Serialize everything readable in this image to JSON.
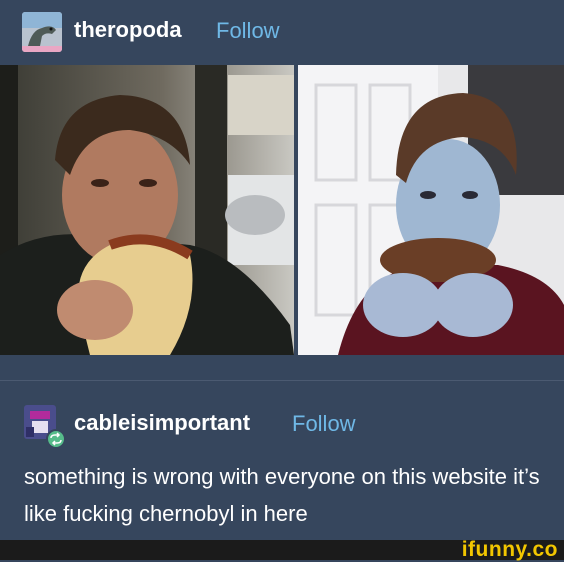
{
  "post": {
    "author": "theropoda",
    "follow_label": "Follow",
    "photos": [
      {
        "description": "man in dark jacket biting a wrapped burrito"
      },
      {
        "description": "young man in dark shirt biting a burger in front of a white door"
      }
    ]
  },
  "reblog": {
    "author": "cableisimportant",
    "follow_label": "Follow",
    "text": "something is wrong with everyone on this website it’s like fucking chernobyl in here"
  },
  "watermark": {
    "text": "ifunny.co"
  },
  "colors": {
    "background": "#36465d",
    "follow_link": "#6fb8e6",
    "watermark": "#f2c600"
  },
  "icons": {
    "post_avatar": "dinosaur-avatar-icon",
    "reblog_avatar": "character-avatar-icon",
    "reblog_badge": "reblog-icon"
  }
}
